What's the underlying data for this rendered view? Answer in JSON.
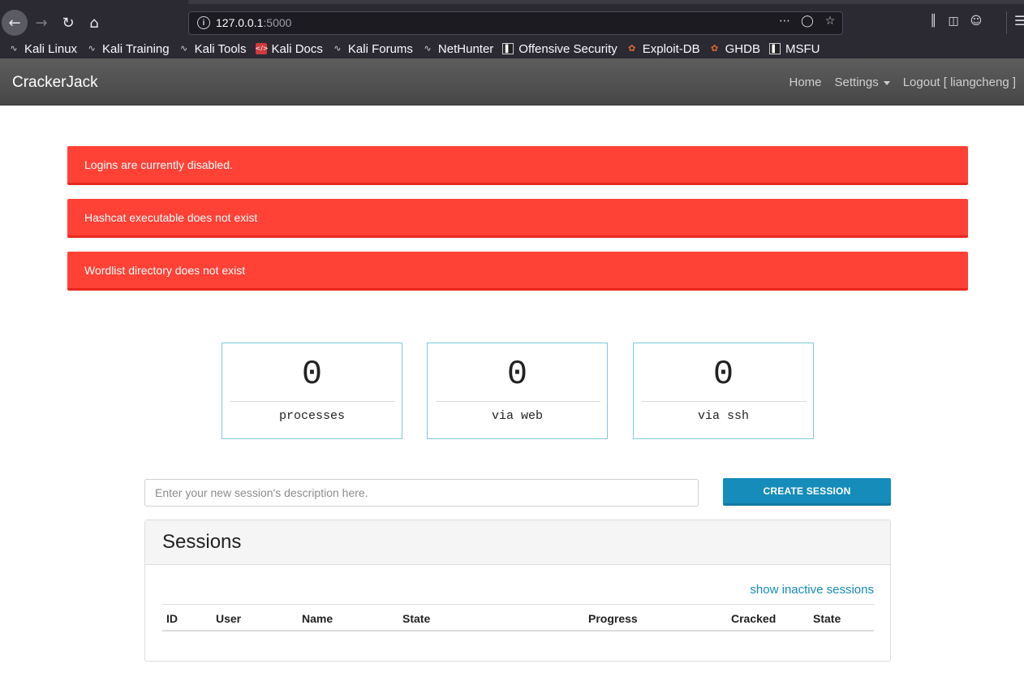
{
  "browser": {
    "url_host": "127.0.0.1",
    "url_port": ":5000",
    "bookmarks": [
      {
        "label": "Kali Linux",
        "icon": "kali-dragon-icon"
      },
      {
        "label": "Kali Training",
        "icon": "kali-dragon-icon"
      },
      {
        "label": "Kali Tools",
        "icon": "kali-dragon-icon"
      },
      {
        "label": "Kali Docs",
        "icon": "kali-docs-icon"
      },
      {
        "label": "Kali Forums",
        "icon": "kali-dragon-icon"
      },
      {
        "label": "NetHunter",
        "icon": "nethunter-icon"
      },
      {
        "label": "Offensive Security",
        "icon": "offsec-icon"
      },
      {
        "label": "Exploit-DB",
        "icon": "exploit-db-icon"
      },
      {
        "label": "GHDB",
        "icon": "exploit-db-icon"
      },
      {
        "label": "MSFU",
        "icon": "offsec-icon"
      }
    ]
  },
  "navbar": {
    "brand": "CrackerJack",
    "home": "Home",
    "settings": "Settings",
    "logout": "Logout [ liangcheng ]"
  },
  "alerts": [
    "Logins are currently disabled.",
    "Hashcat executable does not exist",
    "Wordlist directory does not exist"
  ],
  "stats": [
    {
      "value": "0",
      "label": "processes"
    },
    {
      "value": "0",
      "label": "via web"
    },
    {
      "value": "0",
      "label": "via ssh"
    }
  ],
  "session_form": {
    "placeholder": "Enter your new session's description here.",
    "button": "CREATE SESSION"
  },
  "sessions": {
    "title": "Sessions",
    "inactive_link": "show inactive sessions",
    "columns": [
      "ID",
      "User",
      "Name",
      "State",
      "Progress",
      "Cracked",
      "State"
    ]
  },
  "colors": {
    "alert": "#ff4136",
    "primary": "#158cba",
    "card_border": "#7ccbd9",
    "navbar": "#555555"
  }
}
